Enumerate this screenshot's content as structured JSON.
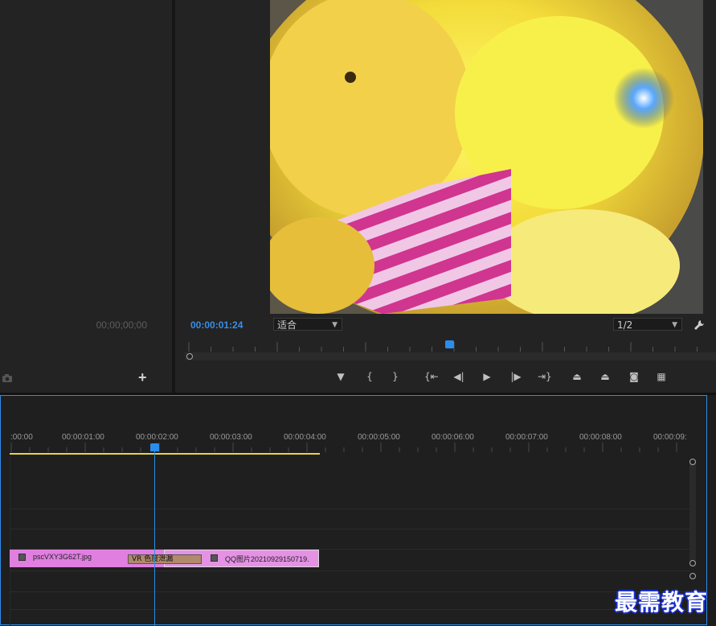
{
  "source_monitor": {
    "timecode": "00;00;00;00",
    "camera_icon": "camera-icon",
    "add_label": "+"
  },
  "program_monitor": {
    "timecode": "00:00:01:24",
    "fit_select": "适合",
    "resolution_select": "1/2",
    "settings_icon": "wrench-icon",
    "playhead_progress": 0.5,
    "controls": [
      {
        "name": "add-marker-button",
        "icon": "marker-icon",
        "glyph": "▼"
      },
      {
        "name": "mark-in-button",
        "icon": "mark-in-icon",
        "glyph": "{"
      },
      {
        "name": "mark-out-button",
        "icon": "mark-out-icon",
        "glyph": "}"
      },
      {
        "name": "go-to-in-button",
        "icon": "go-to-in-icon",
        "glyph": "{⇤"
      },
      {
        "name": "step-back-button",
        "icon": "step-back-icon",
        "glyph": "◀|"
      },
      {
        "name": "play-button",
        "icon": "play-icon",
        "glyph": "▶"
      },
      {
        "name": "step-forward-button",
        "icon": "step-forward-icon",
        "glyph": "|▶"
      },
      {
        "name": "go-to-out-button",
        "icon": "go-to-out-icon",
        "glyph": "⇥}"
      },
      {
        "name": "lift-button",
        "icon": "lift-icon",
        "glyph": "⏏"
      },
      {
        "name": "extract-button",
        "icon": "extract-icon",
        "glyph": "⏏"
      },
      {
        "name": "export-frame-button",
        "icon": "camera-icon",
        "glyph": "◙"
      },
      {
        "name": "compare-button",
        "icon": "compare-icon",
        "glyph": "▦"
      }
    ]
  },
  "timeline": {
    "ruler_labels": [
      ":00:00",
      "00:00:01:00",
      "00:00:02:00",
      "00:00:03:00",
      "00:00:04:00",
      "00:00:05:00",
      "00:00:06:00",
      "00:00:07:00",
      "00:00:08:00",
      "00:00:09:"
    ],
    "clips": [
      {
        "name": "pscVXY3G62T.jpg"
      },
      {
        "name": "QQ图片20210929150719."
      }
    ],
    "transition": "VR 色度泄漏"
  },
  "watermark": "最需教育",
  "colors": {
    "accent": "#2d8ceb",
    "clip": "#e07fe0",
    "work_area": "#e8d34a"
  }
}
